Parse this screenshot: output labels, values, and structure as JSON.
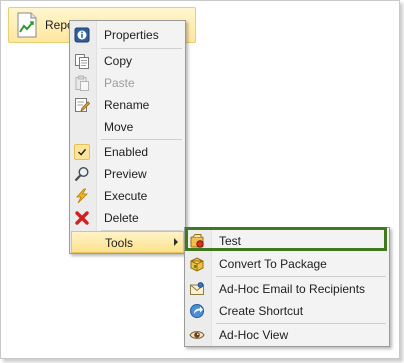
{
  "tile": {
    "label": "Repo",
    "icon": "chart-document-icon"
  },
  "context_menu": {
    "items": [
      {
        "label": "Properties",
        "icon": "properties-icon"
      },
      {
        "label": "Copy",
        "icon": "copy-icon"
      },
      {
        "label": "Paste",
        "icon": "paste-icon",
        "disabled": true
      },
      {
        "label": "Rename",
        "icon": "rename-icon"
      },
      {
        "label": "Move",
        "icon": ""
      },
      {
        "label": "Enabled",
        "icon": "check-icon",
        "checked": true
      },
      {
        "label": "Preview",
        "icon": "magnifier-icon"
      },
      {
        "label": "Execute",
        "icon": "lightning-icon"
      },
      {
        "label": "Delete",
        "icon": "delete-icon"
      },
      {
        "label": "Tools",
        "icon": "",
        "submenu": true
      }
    ]
  },
  "submenu": {
    "items": [
      {
        "label": "Test",
        "icon": "test-icon",
        "outlined": true
      },
      {
        "label": "Convert To Package",
        "icon": "package-icon"
      },
      {
        "label": "Ad-Hoc Email to Recipients",
        "icon": "email-icon"
      },
      {
        "label": "Create Shortcut",
        "icon": "shortcut-icon"
      },
      {
        "label": "Ad-Hoc View",
        "icon": "eye-icon"
      }
    ]
  },
  "colors": {
    "highlight_outline": "#3f7a1f",
    "hover_fill": "#fde28b",
    "tile_fill": "#ffe79e"
  }
}
